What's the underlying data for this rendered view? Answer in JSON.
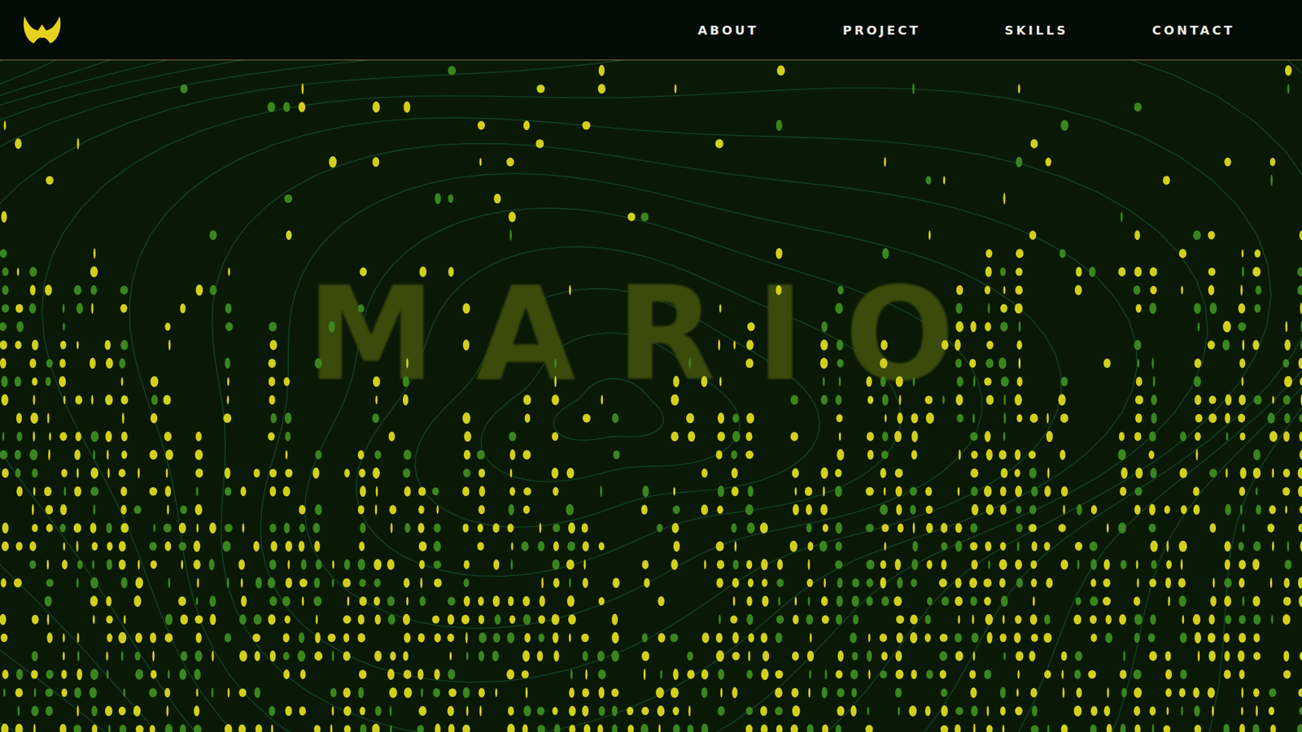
{
  "nav": {
    "links": [
      {
        "label": "ABOUT"
      },
      {
        "label": "PROJECT"
      },
      {
        "label": "SKILLS"
      },
      {
        "label": "CONTACT"
      }
    ]
  },
  "hero": {
    "title": "MARIO"
  }
}
